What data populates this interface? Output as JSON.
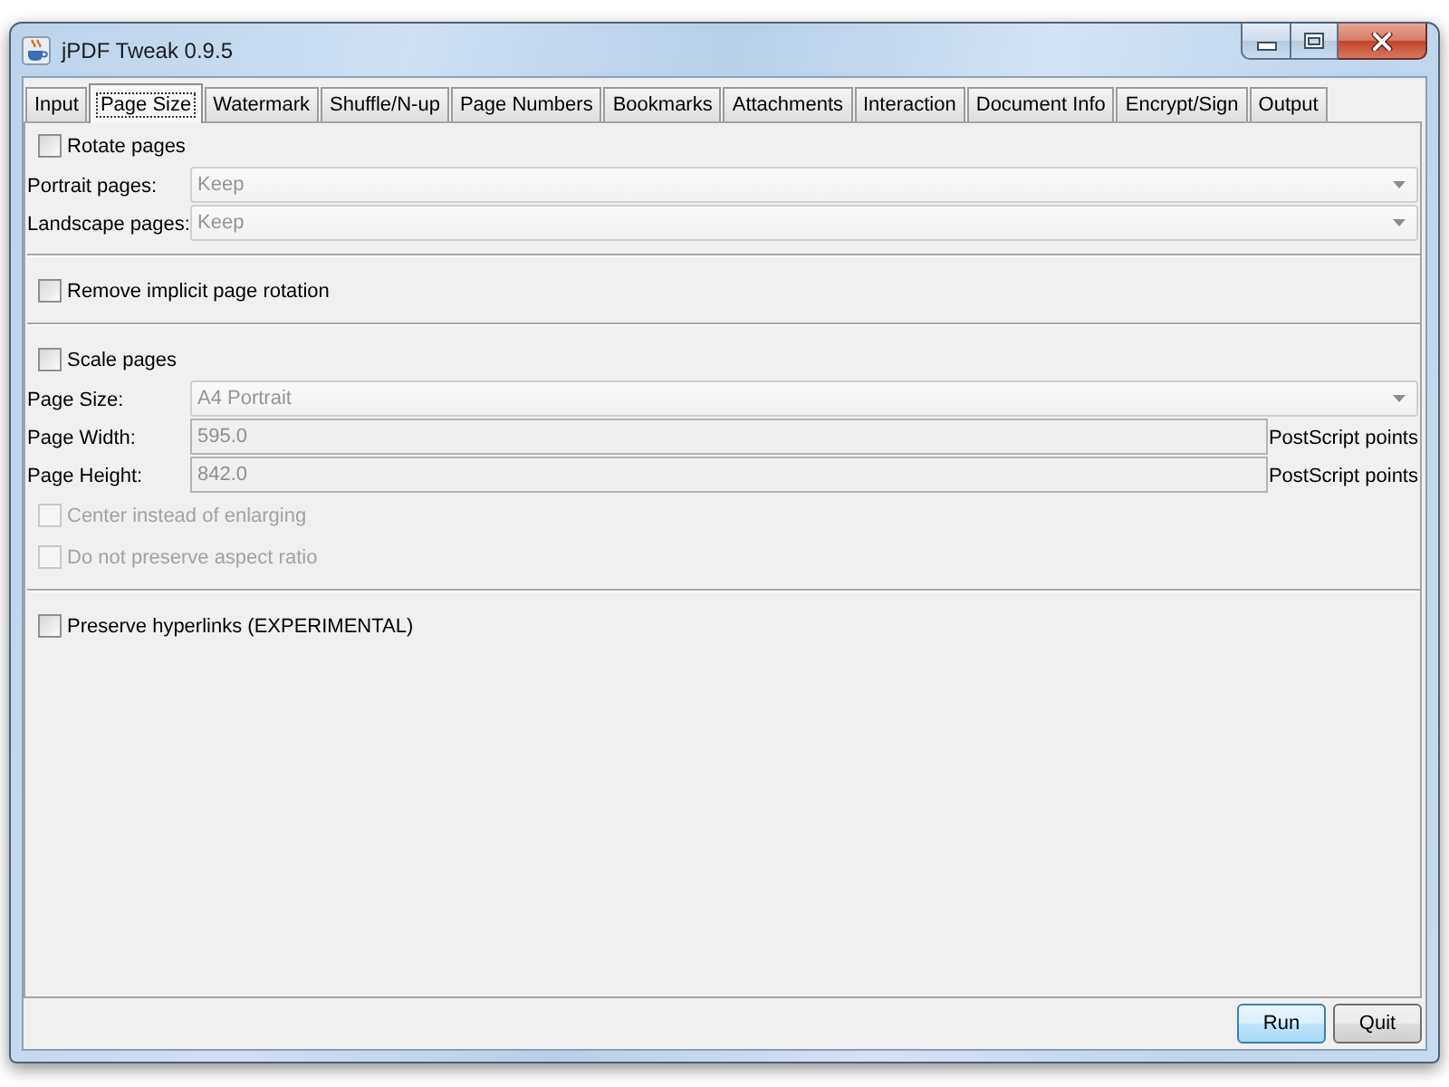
{
  "window": {
    "title": "jPDF Tweak 0.9.5"
  },
  "tabs": [
    {
      "label": "Input",
      "selected": false
    },
    {
      "label": "Page Size",
      "selected": true
    },
    {
      "label": "Watermark",
      "selected": false
    },
    {
      "label": "Shuffle/N-up",
      "selected": false
    },
    {
      "label": "Page Numbers",
      "selected": false
    },
    {
      "label": "Bookmarks",
      "selected": false
    },
    {
      "label": "Attachments",
      "selected": false
    },
    {
      "label": "Interaction",
      "selected": false
    },
    {
      "label": "Document Info",
      "selected": false
    },
    {
      "label": "Encrypt/Sign",
      "selected": false
    },
    {
      "label": "Output",
      "selected": false
    }
  ],
  "sections": [
    {
      "items": [
        {
          "kind": "checkbox",
          "label": "Rotate pages",
          "checked": false,
          "disabled": false
        },
        {
          "kind": "dropdown",
          "label": "Portrait pages:",
          "value": "Keep",
          "disabled": true
        },
        {
          "kind": "dropdown",
          "label": "Landscape pages:",
          "value": "Keep",
          "disabled": true
        }
      ]
    },
    {
      "items": [
        {
          "kind": "checkbox",
          "label": "Remove implicit page rotation",
          "checked": false,
          "disabled": false
        }
      ]
    },
    {
      "items": [
        {
          "kind": "checkbox",
          "label": "Scale pages",
          "checked": false,
          "disabled": false
        },
        {
          "kind": "dropdown",
          "label": "Page Size:",
          "value": "A4 Portrait",
          "disabled": true
        },
        {
          "kind": "field",
          "label": "Page Width:",
          "value": "595.0",
          "unit": "PostScript points",
          "disabled": true
        },
        {
          "kind": "field",
          "label": "Page Height:",
          "value": "842.0",
          "unit": "PostScript points",
          "disabled": true
        },
        {
          "kind": "checkbox",
          "label": "Center instead of enlarging",
          "checked": false,
          "disabled": true
        },
        {
          "kind": "checkbox",
          "label": "Do not preserve aspect ratio",
          "checked": false,
          "disabled": true
        }
      ]
    },
    {
      "items": [
        {
          "kind": "checkbox",
          "label": "Preserve hyperlinks (EXPERIMENTAL)",
          "checked": false,
          "disabled": false
        }
      ]
    }
  ],
  "buttons": [
    {
      "label": "Run",
      "focused": true
    },
    {
      "label": "Quit",
      "focused": false
    }
  ]
}
